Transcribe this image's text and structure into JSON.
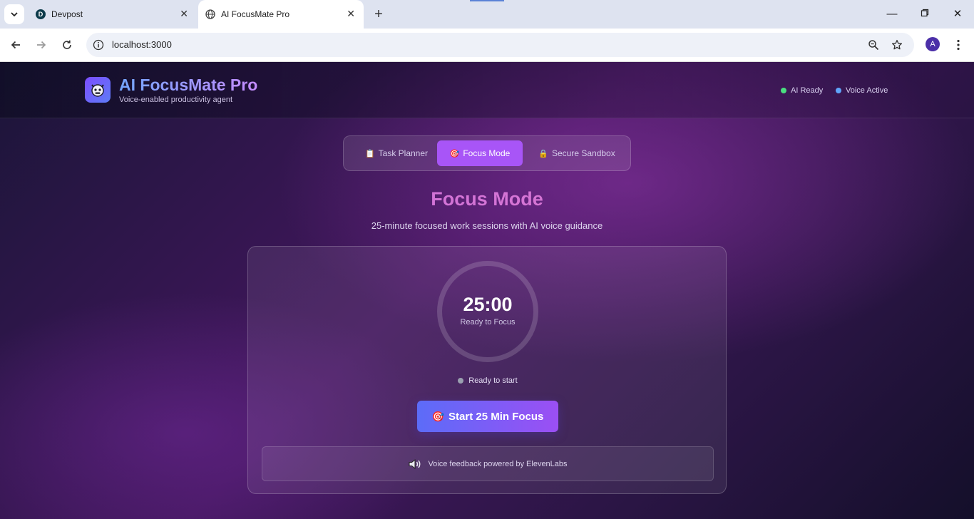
{
  "browser": {
    "tabs": [
      {
        "title": "Devpost",
        "favicon": "D",
        "active": false
      },
      {
        "title": "AI FocusMate Pro",
        "active": true
      }
    ],
    "url": "localhost:3000",
    "profile_initial": "A"
  },
  "app": {
    "title": "AI FocusMate Pro",
    "subtitle": "Voice-enabled productivity agent",
    "status": [
      {
        "label": "AI Ready",
        "color": "#4ade80"
      },
      {
        "label": "Voice Active",
        "color": "#60a5fa"
      }
    ],
    "tabs": [
      {
        "label": "Task Planner",
        "icon": "📋",
        "active": false
      },
      {
        "label": "Focus Mode",
        "icon": "🎯",
        "active": true
      },
      {
        "label": "Secure Sandbox",
        "icon": "🔒",
        "active": false
      }
    ]
  },
  "focus": {
    "title": "Focus Mode",
    "subtitle": "25-minute focused work sessions with AI voice guidance",
    "timer": "25:00",
    "timer_state": "Ready to Focus",
    "ready_text": "Ready to start",
    "start_button": "Start 25 Min Focus",
    "start_icon": "🎯",
    "voice_note": "Voice feedback powered by ElevenLabs"
  },
  "colors": {
    "accent": "#a855f7",
    "button_start": "#5c6cf8",
    "button_end": "#9b4ff4"
  }
}
